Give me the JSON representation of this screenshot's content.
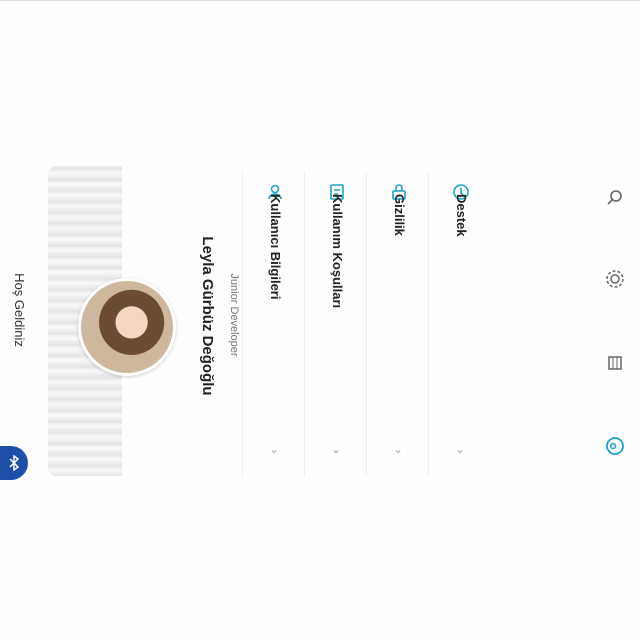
{
  "header": {
    "welcome": "Hoş Geldiniz"
  },
  "profile": {
    "name": "Leyla Gürbüz Değoğlu",
    "role": "Junior Developer"
  },
  "menu": {
    "items": [
      {
        "label": "Destek",
        "icon": "support-icon"
      },
      {
        "label": "Gizlilik",
        "icon": "lock-icon"
      },
      {
        "label": "Kullanım Koşulları",
        "icon": "terms-icon"
      },
      {
        "label": "Kullanıcı Bilgileri",
        "icon": "user-icon"
      }
    ]
  },
  "sidebar": {
    "icons": [
      "search-icon",
      "settings-icon",
      "building-icon",
      "profile-icon"
    ],
    "accent": "#1aa3c9"
  },
  "colors": {
    "brand": "#1e4fa8",
    "accent": "#1aa3c9"
  }
}
